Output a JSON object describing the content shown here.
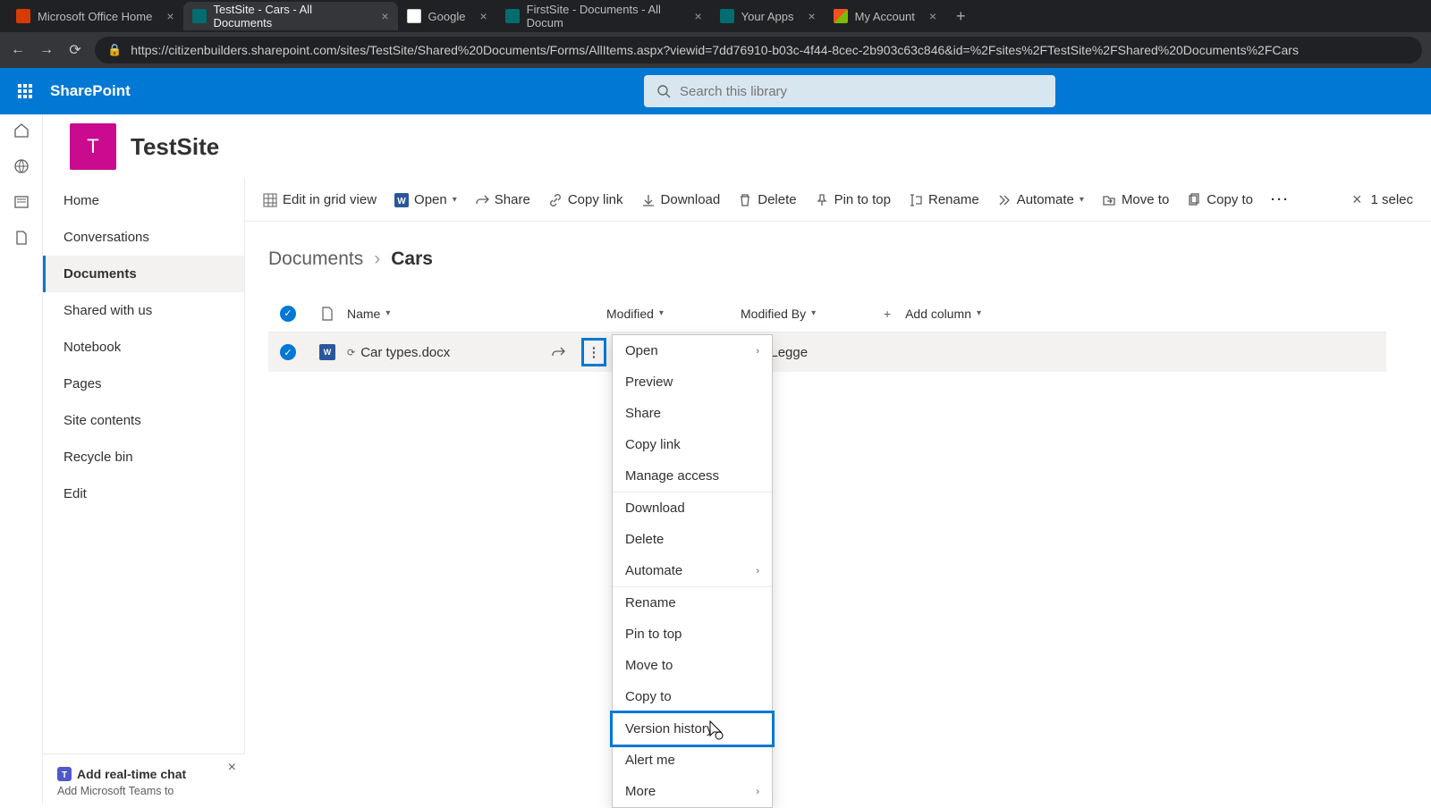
{
  "tabs": [
    {
      "label": "Microsoft Office Home"
    },
    {
      "label": "TestSite - Cars - All Documents"
    },
    {
      "label": "Google"
    },
    {
      "label": "FirstSite - Documents - All Docum"
    },
    {
      "label": "Your Apps"
    },
    {
      "label": "My Account"
    }
  ],
  "url": "https://citizenbuilders.sharepoint.com/sites/TestSite/Shared%20Documents/Forms/AllItems.aspx?viewid=7dd76910-b03c-4f44-8cec-2b903c63c846&id=%2Fsites%2FTestSite%2FShared%20Documents%2FCars",
  "brand": "SharePoint",
  "search_placeholder": "Search this library",
  "site": {
    "logo": "T",
    "title": "TestSite"
  },
  "nav_items": [
    "Home",
    "Conversations",
    "Documents",
    "Shared with us",
    "Notebook",
    "Pages",
    "Site contents",
    "Recycle bin",
    "Edit"
  ],
  "nav_active_index": 2,
  "commands": {
    "edit_grid": "Edit in grid view",
    "open": "Open",
    "share": "Share",
    "copylink": "Copy link",
    "download": "Download",
    "delete": "Delete",
    "pin": "Pin to top",
    "rename": "Rename",
    "automate": "Automate",
    "moveto": "Move to",
    "copyto": "Copy to"
  },
  "selection": "1 selec",
  "breadcrumb": {
    "parent": "Documents",
    "current": "Cars"
  },
  "columns": {
    "name": "Name",
    "modified": "Modified",
    "modifiedby": "Modified By",
    "add": "Add column"
  },
  "row": {
    "filename": "Car types.docx",
    "modifiedby": "enry Legge"
  },
  "context_menu": [
    "Open",
    "Preview",
    "Share",
    "Copy link",
    "Manage access",
    "Download",
    "Delete",
    "Automate",
    "Rename",
    "Pin to top",
    "Move to",
    "Copy to",
    "Version history",
    "Alert me",
    "More"
  ],
  "context_submenu_indices": [
    0,
    7,
    14
  ],
  "context_sep_after": [
    4,
    7,
    11
  ],
  "context_highlight_index": 12,
  "promo": {
    "title": "Add real-time chat",
    "body": "Add Microsoft Teams to"
  }
}
